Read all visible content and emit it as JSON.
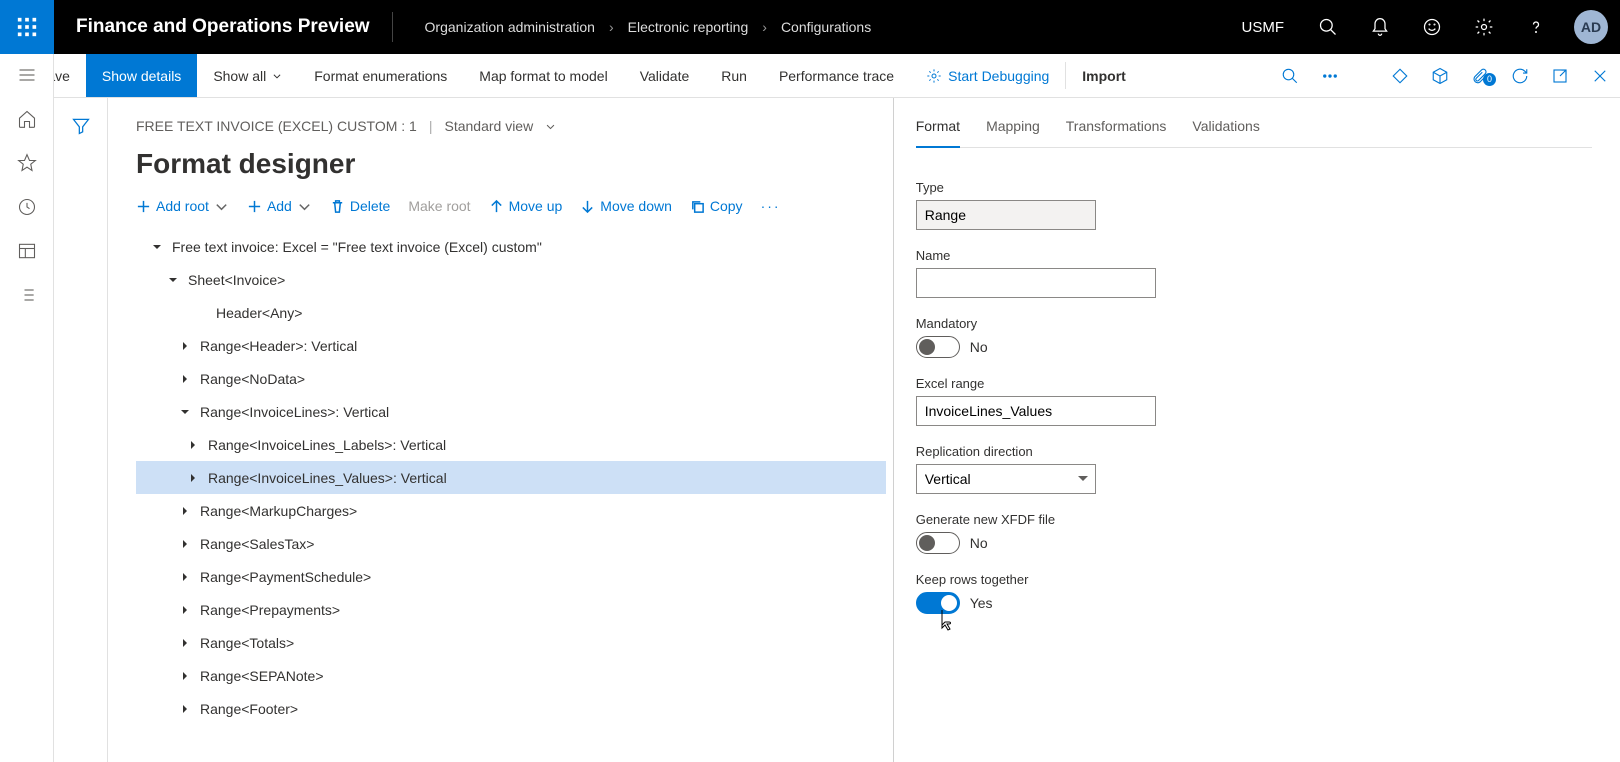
{
  "app_title": "Finance and Operations Preview",
  "breadcrumb": [
    "Organization administration",
    "Electronic reporting",
    "Configurations"
  ],
  "company": "USMF",
  "avatar": "AD",
  "actionbar": {
    "save": "Save",
    "show_details": "Show details",
    "show_all": "Show all",
    "format_enum": "Format enumerations",
    "map_format": "Map format to model",
    "validate": "Validate",
    "run": "Run",
    "perf_trace": "Performance trace",
    "start_debug": "Start Debugging",
    "import": "Import"
  },
  "view_line": {
    "config": "FREE TEXT INVOICE (EXCEL) CUSTOM : 1",
    "view": "Standard view"
  },
  "page_title": "Format designer",
  "toolbar": {
    "add_root": "Add root",
    "add": "Add",
    "delete": "Delete",
    "make_root": "Make root",
    "move_up": "Move up",
    "move_down": "Move down",
    "copy": "Copy"
  },
  "tree": {
    "n0": "Free text invoice: Excel = \"Free text invoice (Excel) custom\"",
    "n1": "Sheet<Invoice>",
    "n2": "Header<Any>",
    "n3": "Range<Header>: Vertical",
    "n4": "Range<NoData>",
    "n5": "Range<InvoiceLines>: Vertical",
    "n6": "Range<InvoiceLines_Labels>: Vertical",
    "n7": "Range<InvoiceLines_Values>: Vertical",
    "n8": "Range<MarkupCharges>",
    "n9": "Range<SalesTax>",
    "n10": "Range<PaymentSchedule>",
    "n11": "Range<Prepayments>",
    "n12": "Range<Totals>",
    "n13": "Range<SEPANote>",
    "n14": "Range<Footer>"
  },
  "tabs": {
    "format": "Format",
    "mapping": "Mapping",
    "transform": "Transformations",
    "valid": "Validations"
  },
  "form": {
    "type_label": "Type",
    "type_value": "Range",
    "name_label": "Name",
    "name_value": "",
    "mand_label": "Mandatory",
    "mand_text": "No",
    "excel_label": "Excel range",
    "excel_value": "InvoiceLines_Values",
    "repl_label": "Replication direction",
    "repl_value": "Vertical",
    "xfdf_label": "Generate new XFDF file",
    "xfdf_text": "No",
    "keep_label": "Keep rows together",
    "keep_text": "Yes"
  }
}
